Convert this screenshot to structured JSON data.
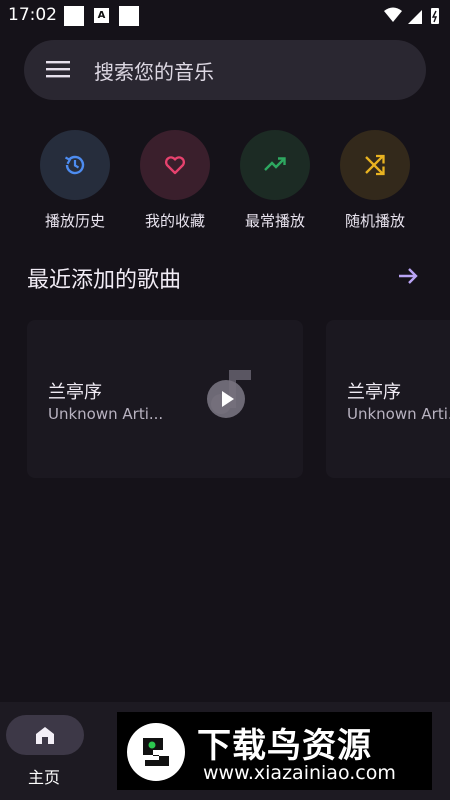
{
  "status": {
    "time": "17:02"
  },
  "search": {
    "placeholder": "搜索您的音乐"
  },
  "quick_actions": [
    {
      "label": "播放历史",
      "icon": "history-icon",
      "color": "#4d8cf0",
      "bg": "#262d3c"
    },
    {
      "label": "我的收藏",
      "icon": "heart-icon",
      "color": "#e6426e",
      "bg": "#3a1f2c"
    },
    {
      "label": "最常播放",
      "icon": "trending-up-icon",
      "color": "#2ea860",
      "bg": "#1c2b24"
    },
    {
      "label": "随机播放",
      "icon": "shuffle-icon",
      "color": "#e9b321",
      "bg": "#33291b"
    }
  ],
  "recent": {
    "title": "最近添加的歌曲",
    "cards": [
      {
        "title": "兰亭序",
        "artist": "Unknown Arti..."
      },
      {
        "title": "兰亭序",
        "artist": "Unknown Arti..."
      }
    ]
  },
  "bottom_nav": {
    "home_label": "主页"
  },
  "watermark": {
    "title": "下载鸟资源",
    "url": "www.xiazainiao.com"
  },
  "colors": {
    "accent": "#b9a4f5",
    "background": "#151219"
  }
}
